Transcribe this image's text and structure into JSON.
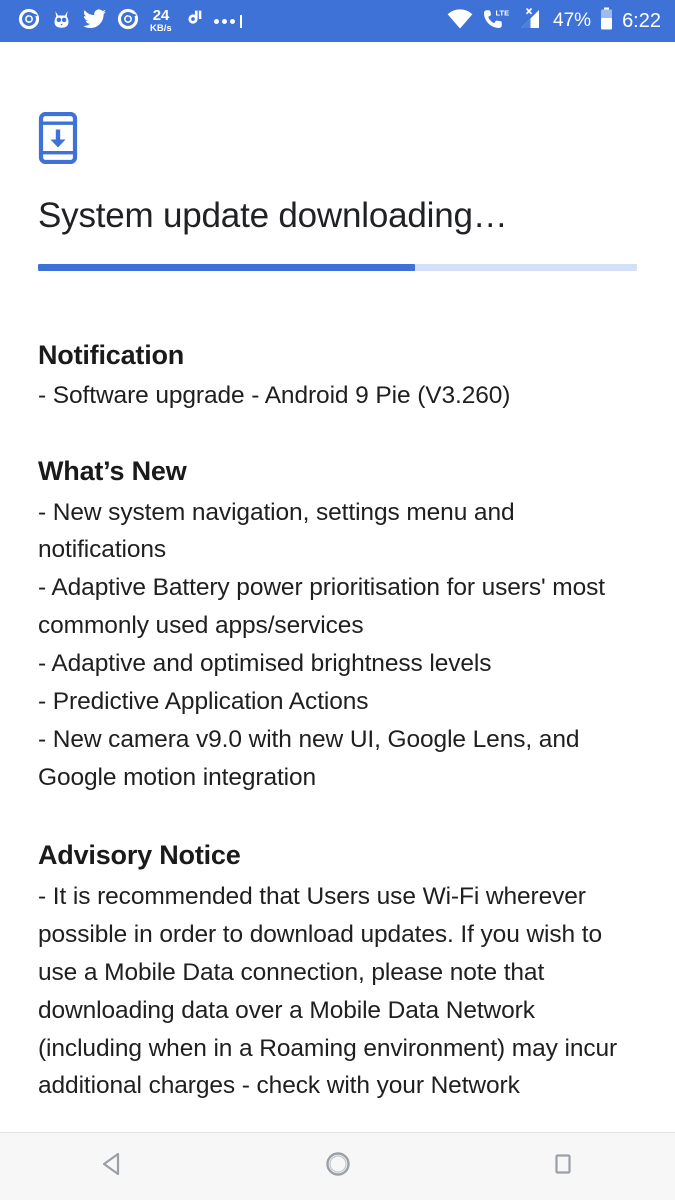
{
  "status_bar": {
    "background": "#3f72d7",
    "notification_icons": [
      {
        "name": "chrome-icon"
      },
      {
        "name": "owl-app-icon"
      },
      {
        "name": "twitter-icon"
      },
      {
        "name": "chrome-icon-2"
      },
      {
        "name": "network-speed-indicator"
      },
      {
        "name": "music-app-icon"
      },
      {
        "name": "more-notifications-icon"
      }
    ],
    "network_speed_value": "24",
    "network_speed_unit": "KB/s",
    "more_indicator": "•••",
    "wifi_icon": "wifi-icon",
    "lte_icon": "lte-call-icon",
    "lte_label": "LTE",
    "signal_icon": "signal-bars-icon",
    "signal_x_mark": "X",
    "battery_percent": "47%",
    "battery_icon": "battery-icon",
    "time": "6:22"
  },
  "main": {
    "icon": "system-update-download-icon",
    "title": "System update downloading…",
    "progress": {
      "percent": 63,
      "fill_color": "#3f72d7",
      "track_color": "#d3e0f8"
    },
    "sections": [
      {
        "id": "notification",
        "heading": "Notification",
        "body": "- Software upgrade - Android 9 Pie (V3.260)"
      },
      {
        "id": "whatsnew",
        "heading": "What’s New",
        "body": "- New system navigation, settings menu and notifications\n- Adaptive Battery power prioritisation for users' most commonly used apps/services\n- Adaptive and optimised brightness levels\n- Predictive Application Actions\n- New camera v9.0 with new UI, Google Lens, and Google motion integration"
      },
      {
        "id": "advisory",
        "heading": "Advisory Notice",
        "body": "- It is recommended that Users use Wi-Fi wherever possible in order to download updates. If you wish to use a Mobile Data connection, please note that downloading data over a Mobile Data Network (including when in a Roaming environment) may incur additional charges - check with your Network"
      }
    ]
  },
  "nav_bar": {
    "background": "#f7f7f7",
    "buttons": [
      {
        "name": "back-button",
        "icon": "back-triangle-icon"
      },
      {
        "name": "home-button",
        "icon": "home-circle-icon"
      },
      {
        "name": "recents-button",
        "icon": "recents-square-icon"
      }
    ]
  }
}
